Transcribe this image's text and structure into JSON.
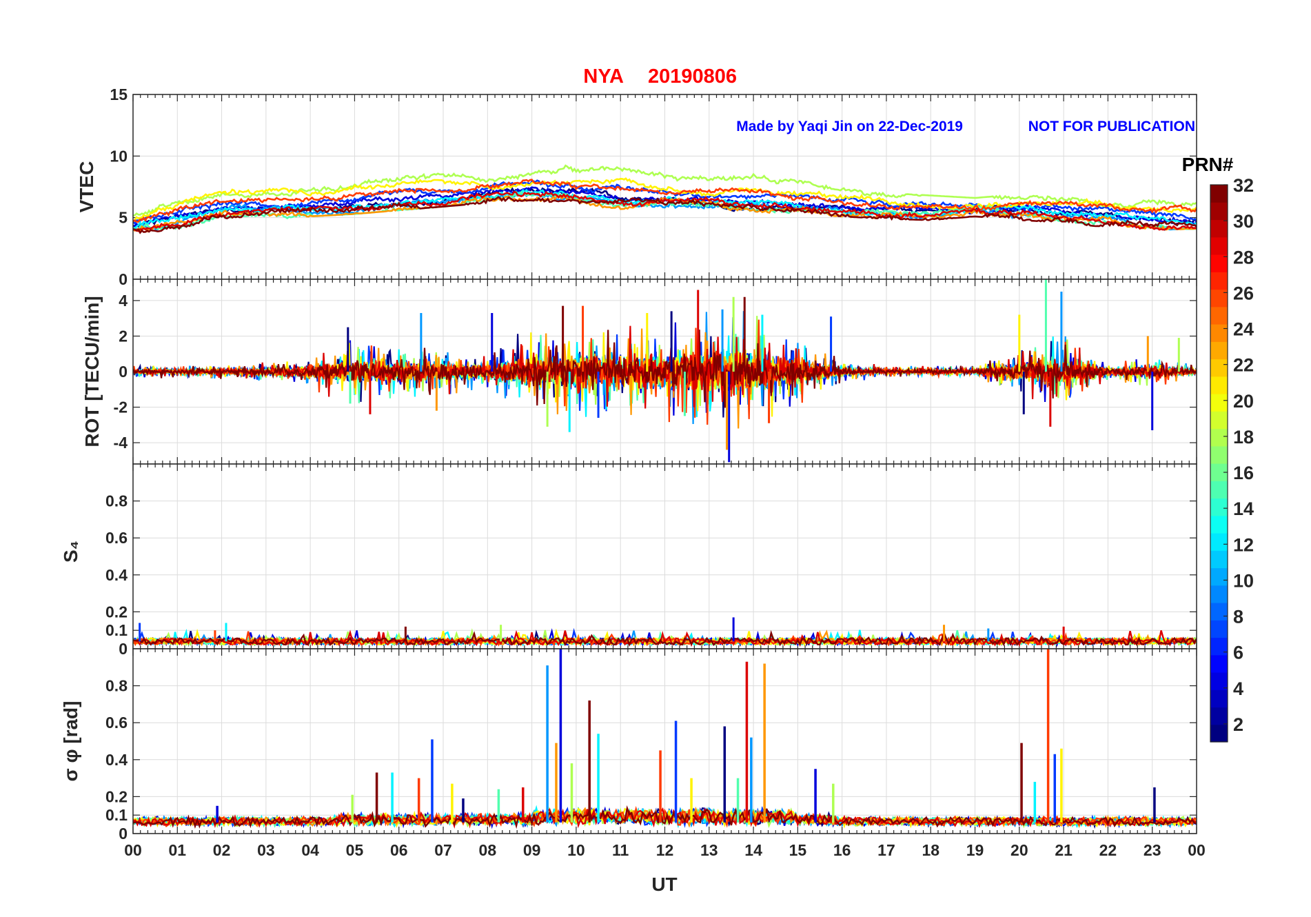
{
  "title_station": "NYA",
  "title_date": "20190806",
  "credit": "Made by Yaqi Jin on 22-Dec-2019",
  "notice": "NOT FOR PUBLICATION",
  "colors": {
    "title": "#ff0000",
    "credit": "#0000ff",
    "axis": "#262626",
    "grid": "#dcdcdc"
  },
  "chart_data": [
    {
      "type": "line",
      "panel": "vtec",
      "ylabel": "VTEC",
      "ylim": [
        0,
        15
      ],
      "yticks": [
        0,
        5,
        10,
        15
      ],
      "xlim": [
        0,
        24
      ],
      "grid": true,
      "x": [
        0,
        1,
        2,
        3,
        4,
        5,
        6,
        7,
        8,
        9,
        10,
        11,
        12,
        13,
        14,
        15,
        16,
        17,
        18,
        19,
        20,
        21,
        22,
        23,
        24
      ],
      "envelope": {
        "median": [
          4.6,
          5.4,
          6.2,
          6.3,
          6.4,
          6.6,
          6.9,
          7.1,
          7.3,
          7.6,
          7.6,
          7.4,
          7.1,
          6.9,
          6.9,
          6.6,
          6.2,
          5.9,
          5.8,
          5.9,
          6.0,
          5.9,
          5.6,
          5.4,
          5.2
        ],
        "low": [
          3.8,
          3.7,
          4.7,
          4.8,
          5.3,
          5.5,
          5.8,
          6.1,
          6.4,
          6.6,
          6.1,
          5.9,
          6.0,
          5.6,
          5.5,
          5.5,
          5.3,
          5.1,
          5.0,
          5.3,
          5.0,
          4.8,
          4.4,
          4.2,
          4.3
        ],
        "high": [
          5.4,
          6.8,
          7.8,
          7.6,
          8.4,
          8.8,
          8.9,
          9.5,
          9.0,
          9.6,
          9.4,
          10.2,
          9.0,
          8.8,
          9.1,
          8.5,
          7.5,
          7.0,
          6.8,
          6.6,
          6.9,
          7.6,
          7.0,
          7.6,
          7.5
        ]
      }
    },
    {
      "type": "line",
      "panel": "rot",
      "ylabel": "ROT [TECU/min]",
      "ylim": [
        -5.2,
        5.2
      ],
      "yticks": [
        -4,
        -2,
        0,
        2,
        4
      ],
      "xlim": [
        0,
        24
      ],
      "grid": true,
      "activity_x": [
        0,
        1,
        2,
        3,
        4,
        5,
        6,
        7,
        8,
        9,
        10,
        11,
        12,
        13,
        14,
        15,
        16,
        17,
        18,
        19,
        20,
        21,
        22,
        23,
        24
      ],
      "activity_amplitude": [
        0.3,
        0.3,
        0.4,
        0.5,
        0.9,
        1.6,
        1.4,
        1.3,
        1.0,
        2.2,
        2.3,
        2.2,
        2.4,
        3.0,
        2.8,
        1.8,
        0.6,
        0.3,
        0.3,
        0.3,
        1.2,
        1.8,
        0.4,
        0.8,
        0.4
      ],
      "spikes": [
        {
          "x": 4.85,
          "y": 2.5
        },
        {
          "x": 4.9,
          "y": -1.8
        },
        {
          "x": 5.35,
          "y": -2.4
        },
        {
          "x": 6.5,
          "y": 3.3
        },
        {
          "x": 6.85,
          "y": -2.2
        },
        {
          "x": 8.1,
          "y": 3.3
        },
        {
          "x": 9.35,
          "y": -3.1
        },
        {
          "x": 9.7,
          "y": 3.7
        },
        {
          "x": 9.85,
          "y": -3.4
        },
        {
          "x": 10.15,
          "y": 3.7
        },
        {
          "x": 10.5,
          "y": -2.6
        },
        {
          "x": 11.6,
          "y": 3.3
        },
        {
          "x": 12.15,
          "y": 3.4
        },
        {
          "x": 12.45,
          "y": -2.5
        },
        {
          "x": 12.75,
          "y": 4.6
        },
        {
          "x": 13.3,
          "y": 3.5
        },
        {
          "x": 13.4,
          "y": -4.4
        },
        {
          "x": 13.45,
          "y": -5.1
        },
        {
          "x": 13.55,
          "y": 4.2
        },
        {
          "x": 13.8,
          "y": 4.2
        },
        {
          "x": 14.2,
          "y": 3.2
        },
        {
          "x": 14.35,
          "y": -2.9
        },
        {
          "x": 15.75,
          "y": 3.1
        },
        {
          "x": 20.0,
          "y": 3.2
        },
        {
          "x": 20.1,
          "y": -2.4
        },
        {
          "x": 20.6,
          "y": 5.5
        },
        {
          "x": 20.7,
          "y": -3.1
        },
        {
          "x": 20.95,
          "y": 4.5
        },
        {
          "x": 22.9,
          "y": 2.0
        },
        {
          "x": 23.0,
          "y": -3.3
        },
        {
          "x": 23.6,
          "y": 1.9
        }
      ]
    },
    {
      "type": "line",
      "panel": "s4",
      "ylabel": "S₄",
      "ylim": [
        0,
        1.0
      ],
      "yticks": [
        0,
        0.1,
        0.2,
        0.4,
        0.6,
        0.8
      ],
      "xlim": [
        0,
        24
      ],
      "grid": true,
      "baseline": 0.04,
      "spikes": [
        {
          "x": 0.15,
          "y": 0.14
        },
        {
          "x": 1.85,
          "y": 0.1
        },
        {
          "x": 2.1,
          "y": 0.14
        },
        {
          "x": 6.15,
          "y": 0.12
        },
        {
          "x": 8.3,
          "y": 0.13
        },
        {
          "x": 13.55,
          "y": 0.17
        },
        {
          "x": 18.3,
          "y": 0.13
        },
        {
          "x": 19.3,
          "y": 0.11
        },
        {
          "x": 21.0,
          "y": 0.12
        }
      ]
    },
    {
      "type": "line",
      "panel": "sigma_phi",
      "ylabel": "σ φ [rad]",
      "ylim": [
        0,
        1.0
      ],
      "yticks": [
        0,
        0.1,
        0.2,
        0.4,
        0.6,
        0.8
      ],
      "xlim": [
        0,
        24
      ],
      "xticks": [
        "00",
        "01",
        "02",
        "03",
        "04",
        "05",
        "06",
        "07",
        "08",
        "09",
        "10",
        "11",
        "12",
        "13",
        "14",
        "15",
        "16",
        "17",
        "18",
        "19",
        "20",
        "21",
        "22",
        "23",
        "00"
      ],
      "xlabel": "UT",
      "grid": true,
      "baseline": 0.06,
      "spikes": [
        {
          "x": 1.9,
          "y": 0.15
        },
        {
          "x": 4.95,
          "y": 0.21
        },
        {
          "x": 5.5,
          "y": 0.33
        },
        {
          "x": 5.85,
          "y": 0.33
        },
        {
          "x": 6.45,
          "y": 0.3
        },
        {
          "x": 6.75,
          "y": 0.51
        },
        {
          "x": 7.2,
          "y": 0.27
        },
        {
          "x": 7.45,
          "y": 0.19
        },
        {
          "x": 8.25,
          "y": 0.24
        },
        {
          "x": 8.8,
          "y": 0.25
        },
        {
          "x": 9.35,
          "y": 0.91
        },
        {
          "x": 9.55,
          "y": 0.49
        },
        {
          "x": 9.65,
          "y": 1.0
        },
        {
          "x": 9.9,
          "y": 0.38
        },
        {
          "x": 10.3,
          "y": 0.72
        },
        {
          "x": 10.5,
          "y": 0.54
        },
        {
          "x": 11.9,
          "y": 0.45
        },
        {
          "x": 12.25,
          "y": 0.61
        },
        {
          "x": 12.6,
          "y": 0.3
        },
        {
          "x": 13.35,
          "y": 0.58
        },
        {
          "x": 13.65,
          "y": 0.3
        },
        {
          "x": 13.85,
          "y": 0.93
        },
        {
          "x": 13.95,
          "y": 0.52
        },
        {
          "x": 14.25,
          "y": 0.92
        },
        {
          "x": 15.4,
          "y": 0.35
        },
        {
          "x": 15.8,
          "y": 0.27
        },
        {
          "x": 20.05,
          "y": 0.49
        },
        {
          "x": 20.35,
          "y": 0.28
        },
        {
          "x": 20.65,
          "y": 1.0
        },
        {
          "x": 20.8,
          "y": 0.43
        },
        {
          "x": 20.95,
          "y": 0.46
        },
        {
          "x": 23.05,
          "y": 0.25
        }
      ]
    }
  ],
  "colorbar": {
    "label": "PRN#",
    "ticks": [
      "2",
      "4",
      "6",
      "8",
      "10",
      "12",
      "14",
      "16",
      "18",
      "20",
      "22",
      "24",
      "26",
      "28",
      "30",
      "32"
    ],
    "range": [
      1,
      32
    ]
  }
}
